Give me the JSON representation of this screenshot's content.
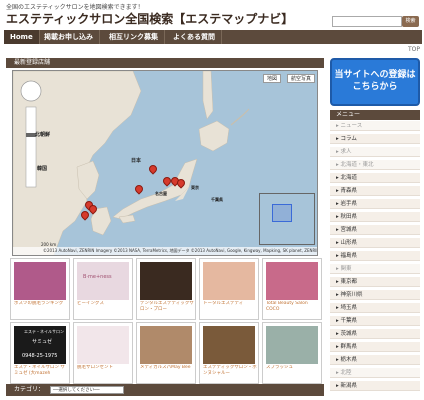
{
  "header": {
    "tagline": "全国のエステティックサロンを地図検索できます！",
    "title": "エステティックサロン全国検索【エステマップナビ】",
    "search_button": "検索"
  },
  "nav": {
    "items": [
      {
        "label": "Home"
      },
      {
        "label": "掲載お申し込み"
      },
      {
        "label": "相互リンク募集"
      },
      {
        "label": "よくある質問"
      }
    ]
  },
  "top_link": "TOP",
  "section": {
    "new_shops_title": "最新登録店舗"
  },
  "map": {
    "btn_map": "地図",
    "btn_aerial": "航空写真",
    "labels": {
      "north_korea": "北朝鮮",
      "korea": "韓国",
      "japan": "日本",
      "nagoya": "名古屋",
      "tokyo": "東京",
      "chiba": "千葉県"
    },
    "scale": "200 km",
    "copyright": "©2013 AutoNavi, ZENRIN Imagery ©2013 NASA, TerraMetrics, 地図データ ©2013 AutoNavi, Google, Kingway, Mapking, SK planet, ZENRIN 利用規約"
  },
  "thumbs": [
    {
      "caption": "ポスツの脱毛ランキング",
      "color": "#b05a8a"
    },
    {
      "caption": "ビーイングス",
      "color": "#e8d8e0"
    },
    {
      "caption": "デンタルエステティックサロン・プロー",
      "color": "#3a2a20"
    },
    {
      "caption": "トータルエステティ",
      "color": "#e5b8a0"
    },
    {
      "caption": "Total Beauty Salon COCO",
      "color": "#c86a8a"
    },
    {
      "caption": "エステ・ネイルサロン サミュゼ (大mazeh",
      "color": "#1a1a1a"
    },
    {
      "caption": "脱毛サロンセント",
      "color": "#f2e6ea"
    },
    {
      "caption": "メディカルスパMay Bee",
      "color": "#b08a6a"
    },
    {
      "caption": "エステティックサロン・ボンヌシャルー",
      "color": "#7a5a3a"
    },
    {
      "caption": "スプラッシュ",
      "color": "#9ab0a8"
    }
  ],
  "thumb_texts": {
    "t2": "B·me+ness",
    "t6_title": "エステ・ネイルサロン",
    "t6_brand": "サミュゼ",
    "t6_phone": "0948-25-1975"
  },
  "category": {
    "label": "カテゴリ：",
    "placeholder": "──選択してください──"
  },
  "sidebar": {
    "banner": "当サイトへの登録はこちらから",
    "menu_title": "メニュー",
    "items": [
      {
        "label": "ニュース",
        "grey": true
      },
      {
        "label": "コラム",
        "grey": false
      },
      {
        "label": "求人",
        "grey": true
      },
      {
        "label": "北海道・東北",
        "grey": true
      },
      {
        "label": "北海道",
        "grey": false
      },
      {
        "label": "青森県",
        "grey": false
      },
      {
        "label": "岩手県",
        "grey": false
      },
      {
        "label": "秋田県",
        "grey": false
      },
      {
        "label": "宮城県",
        "grey": false
      },
      {
        "label": "山形県",
        "grey": false
      },
      {
        "label": "福島県",
        "grey": false
      },
      {
        "label": "関東",
        "grey": true
      },
      {
        "label": "東京都",
        "grey": false
      },
      {
        "label": "神奈川県",
        "grey": false
      },
      {
        "label": "埼玉県",
        "grey": false
      },
      {
        "label": "千葉県",
        "grey": false
      },
      {
        "label": "茨城県",
        "grey": false
      },
      {
        "label": "群馬県",
        "grey": false
      },
      {
        "label": "栃木県",
        "grey": false
      },
      {
        "label": "北陸",
        "grey": true
      },
      {
        "label": "新潟県",
        "grey": false
      }
    ]
  }
}
